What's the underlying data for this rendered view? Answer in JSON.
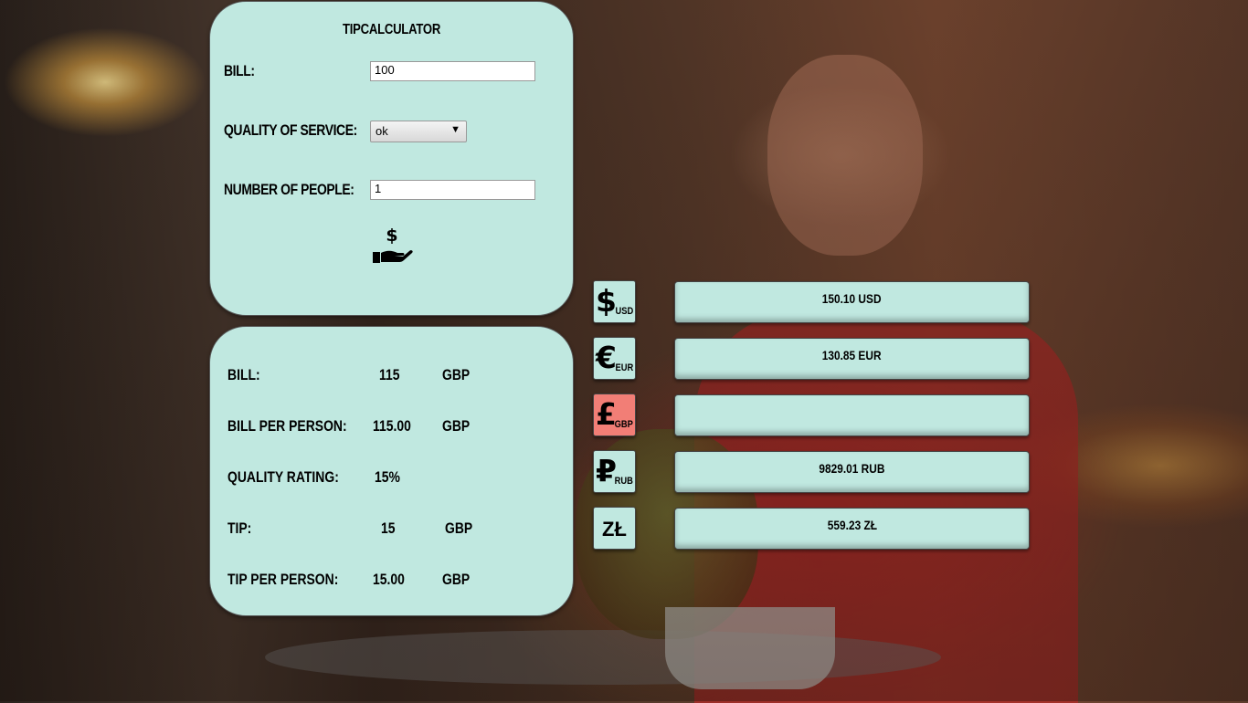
{
  "app": {
    "title": "TIPCALCULATOR"
  },
  "form": {
    "bill_label": "BILL:",
    "bill_value": "100",
    "quality_label": "QUALITY OF SERVICE:",
    "quality_selected": "ok",
    "people_label": "NUMBER OF PEOPLE:",
    "people_value": "1",
    "calculate_icon": "hand-holding-dollar-icon"
  },
  "results": {
    "bill": {
      "label": "BILL:",
      "value": "115",
      "currency": "GBP"
    },
    "bill_per_person": {
      "label": "BILL PER PERSON:",
      "value": "115.00",
      "currency": "GBP"
    },
    "quality_rating": {
      "label": "QUALITY RATING:",
      "value": "15%"
    },
    "tip": {
      "label": "TIP:",
      "value": "15",
      "currency": "GBP"
    },
    "tip_per_person": {
      "label": "TIP PER PERSON:",
      "value": "15.00",
      "currency": "GBP"
    }
  },
  "currencies": [
    {
      "symbol": "$",
      "code": "USD",
      "converted": "150.10 USD",
      "active": false
    },
    {
      "symbol": "€",
      "code": "EUR",
      "converted": "130.85 EUR",
      "active": false
    },
    {
      "symbol": "£",
      "code": "GBP",
      "converted": "",
      "active": true
    },
    {
      "symbol": "₽",
      "code": "RUB",
      "converted": "9829.01 RUB",
      "active": false
    },
    {
      "symbol": "ZŁ",
      "code": "",
      "converted": "559.23 ZŁ",
      "active": false
    }
  ],
  "colors": {
    "card": "#c0e8e0",
    "active_currency": "#f27e76"
  }
}
